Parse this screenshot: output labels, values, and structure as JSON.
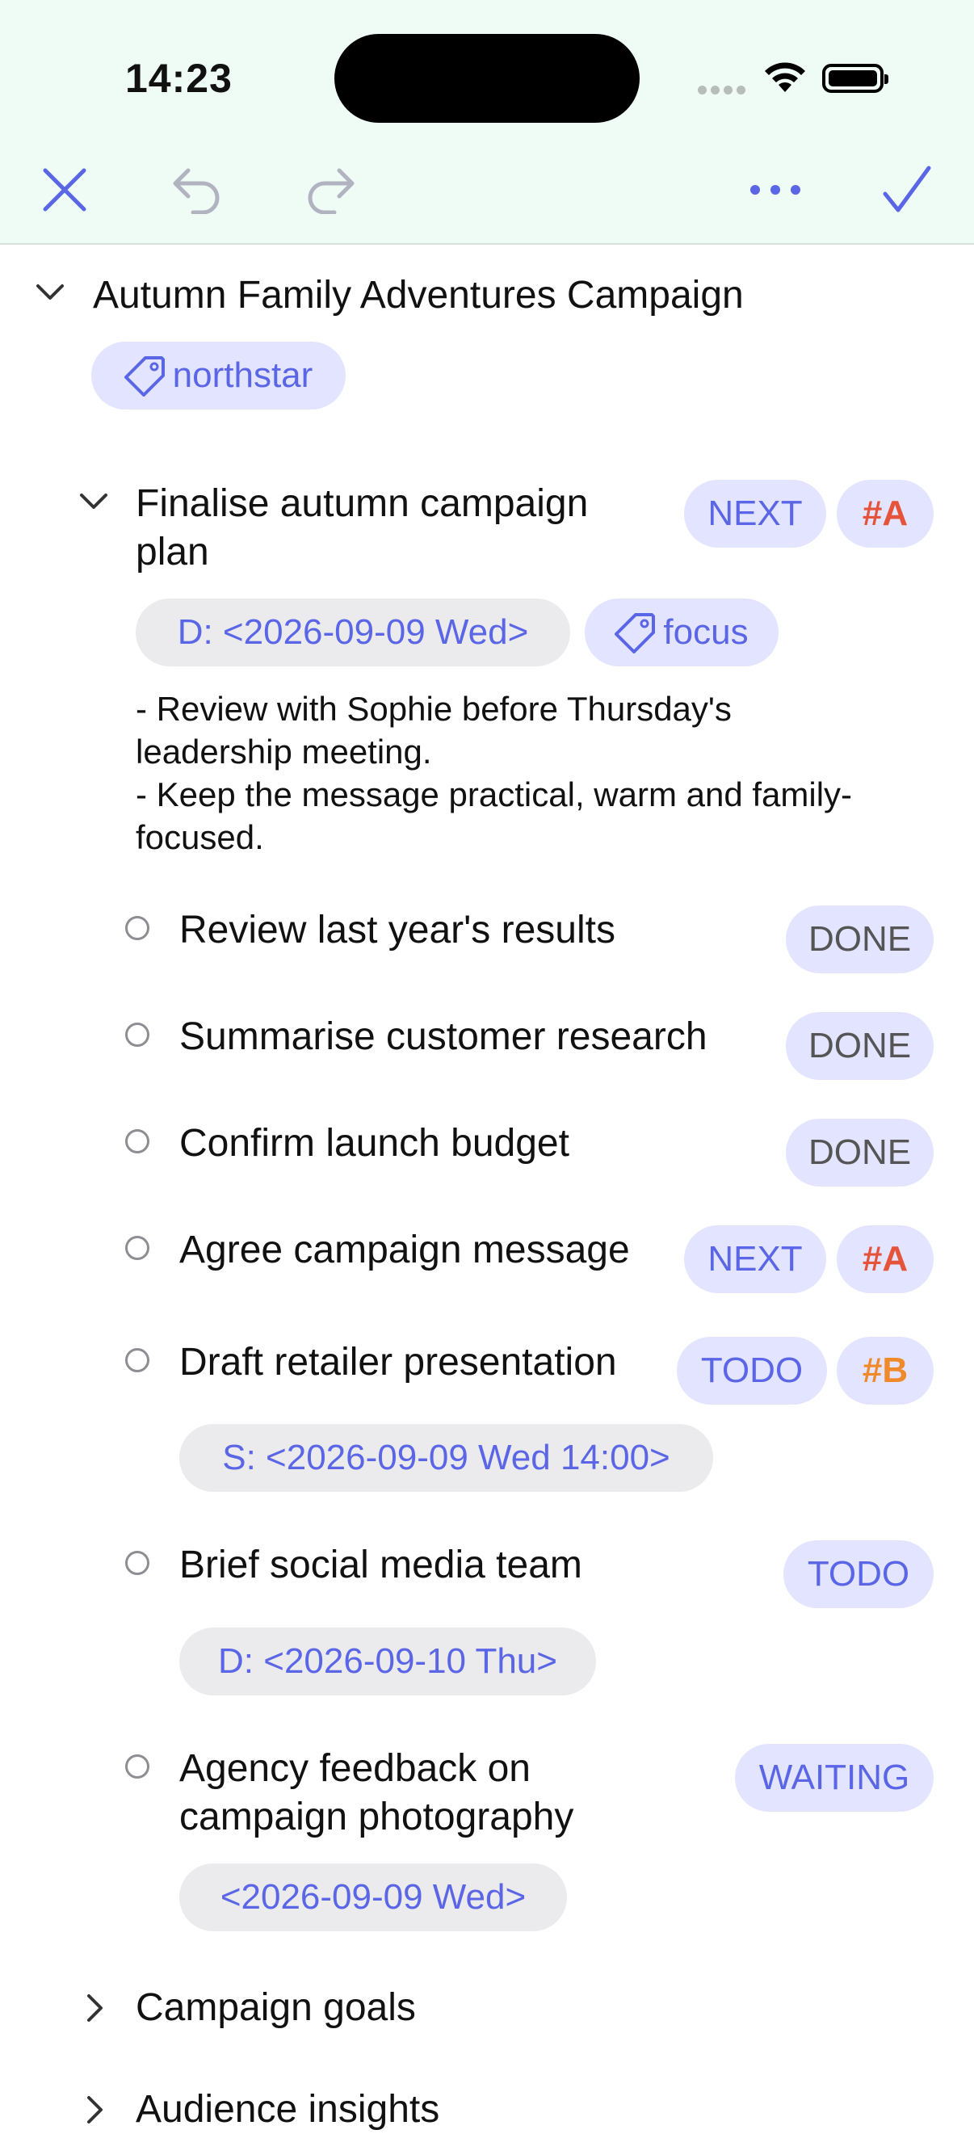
{
  "status_bar": {
    "time": "14:23"
  },
  "toolbar": {
    "close_icon": "x-icon",
    "undo_icon": "undo-arrow-icon",
    "redo_icon": "redo-arrow-icon",
    "more_icon": "ellipsis-icon",
    "confirm_icon": "checkmark-icon",
    "accent": "#5b66e6"
  },
  "campaign": {
    "title": "Autumn Family Adventures Campaign",
    "tag": "northstar"
  },
  "task": {
    "title_line1": "Finalise autumn campaign",
    "title_line2": "plan",
    "state": "NEXT",
    "priority": "#A",
    "deadline": "D: <2026-09-09 Wed>",
    "tag": "focus",
    "notes": "- Review with Sophie before Thursday's\nleadership meeting.\n- Keep the message practical, warm and family-\nfocused."
  },
  "subtasks": [
    {
      "title": "Review last year's results",
      "state": "DONE"
    },
    {
      "title": "Summarise customer research",
      "state": "DONE"
    },
    {
      "title": "Confirm launch budget",
      "state": "DONE"
    },
    {
      "title": "Agree campaign message",
      "state": "NEXT",
      "priority": "#A"
    },
    {
      "title": "Draft retailer presentation",
      "state": "TODO",
      "priority": "#B",
      "date": "S: <2026-09-09 Wed 14:00>"
    },
    {
      "title": "Brief social media team",
      "state": "TODO",
      "date": "D: <2026-09-10 Thu>"
    },
    {
      "title_line1": "Agency feedback on",
      "title_line2": "campaign photography",
      "state": "WAITING",
      "date": "<2026-09-09 Wed>"
    }
  ],
  "sections": [
    {
      "title": "Campaign goals"
    },
    {
      "title": "Audience insights"
    }
  ],
  "colors": {
    "priority_a": "#e5533a",
    "priority_b": "#f0892a",
    "accent": "#5b66e6"
  }
}
